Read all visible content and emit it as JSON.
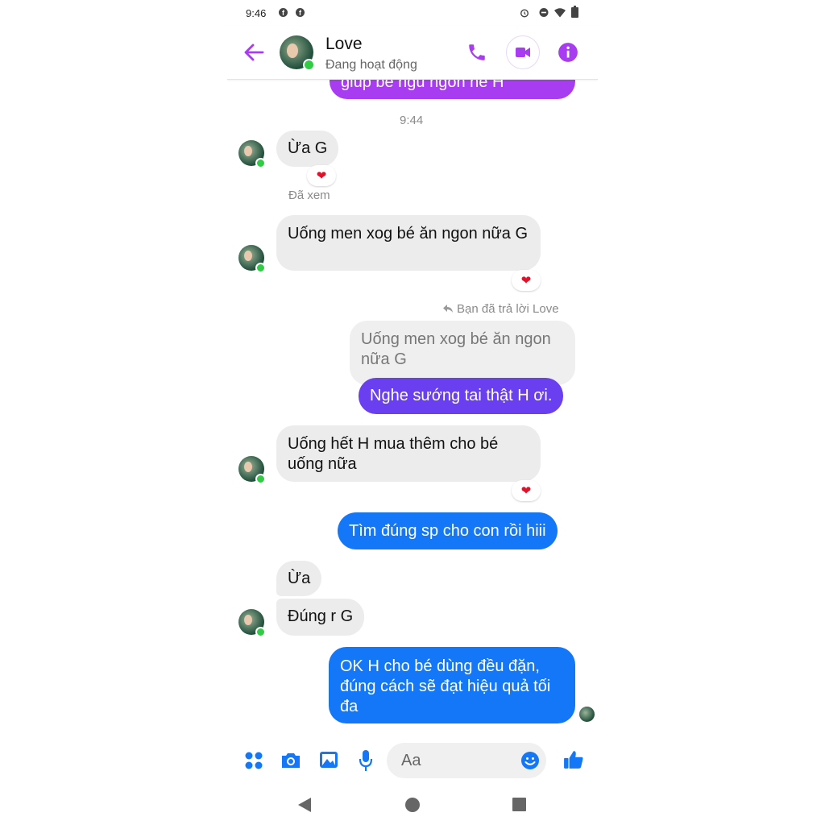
{
  "status_bar": {
    "time": "9:46"
  },
  "header": {
    "name": "Love",
    "status": "Đang hoạt động"
  },
  "colors": {
    "accent": "#a83cf0",
    "sent_blue": "#1477f8",
    "sent_violet": "#6a3ff0",
    "online": "#31cc46"
  },
  "messages": {
    "top_cut": "giúp bé ngủ ngon nè H",
    "timestamp": "9:44",
    "m1": "Ừa G",
    "seen": "Đã xem",
    "m2": "Uống men xog bé ăn ngon nữa G",
    "reply_note": "Bạn đã trả lời Love",
    "quoted": "Uống men xog bé ăn ngon nữa G",
    "m3": "Nghe sướng tai thật H ơi.",
    "m4": "Uống hết H mua thêm cho bé uống nữa",
    "m5": "Tìm đúng sp cho con rồi hiii",
    "m6": "Ừa",
    "m7": "Đúng r G",
    "m8": "OK H cho bé dùng đều đặn, đúng cách sẽ đạt hiệu quả tối đa"
  },
  "reaction_emoji": "❤",
  "composer": {
    "placeholder": "Aa"
  },
  "icons": [
    "back-arrow-icon",
    "phone-icon",
    "video-icon",
    "info-icon",
    "apps-icon",
    "camera-icon",
    "gallery-icon",
    "mic-icon",
    "emoji-icon",
    "like-icon",
    "nav-back-icon",
    "nav-home-icon",
    "nav-recents-icon"
  ]
}
